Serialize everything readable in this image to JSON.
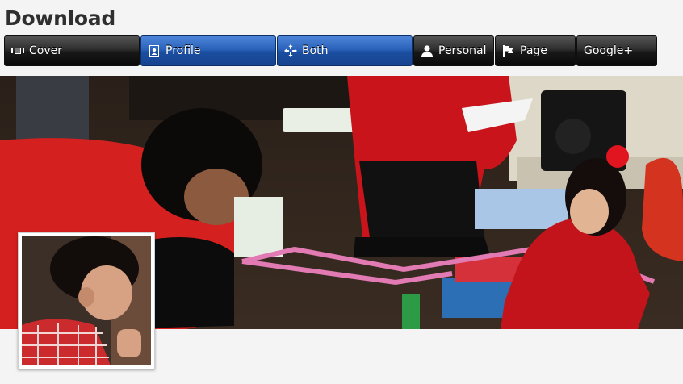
{
  "header": {
    "title": "Download"
  },
  "toolbar": {
    "buttons": [
      {
        "label": "Cover",
        "icon": "cover-icon",
        "active": false
      },
      {
        "label": "Profile",
        "icon": "profile-icon",
        "active": true
      },
      {
        "label": "Both",
        "icon": "move-icon",
        "active": true
      },
      {
        "label": "Personal",
        "icon": "person-icon",
        "active": false
      },
      {
        "label": "Page",
        "icon": "flag-icon",
        "active": false
      },
      {
        "label": "Google+",
        "icon": "",
        "active": false
      }
    ]
  },
  "colors": {
    "active_button": "#2a63bb",
    "inactive_button": "#1a1a1a",
    "page_background": "#f4f4f4"
  }
}
